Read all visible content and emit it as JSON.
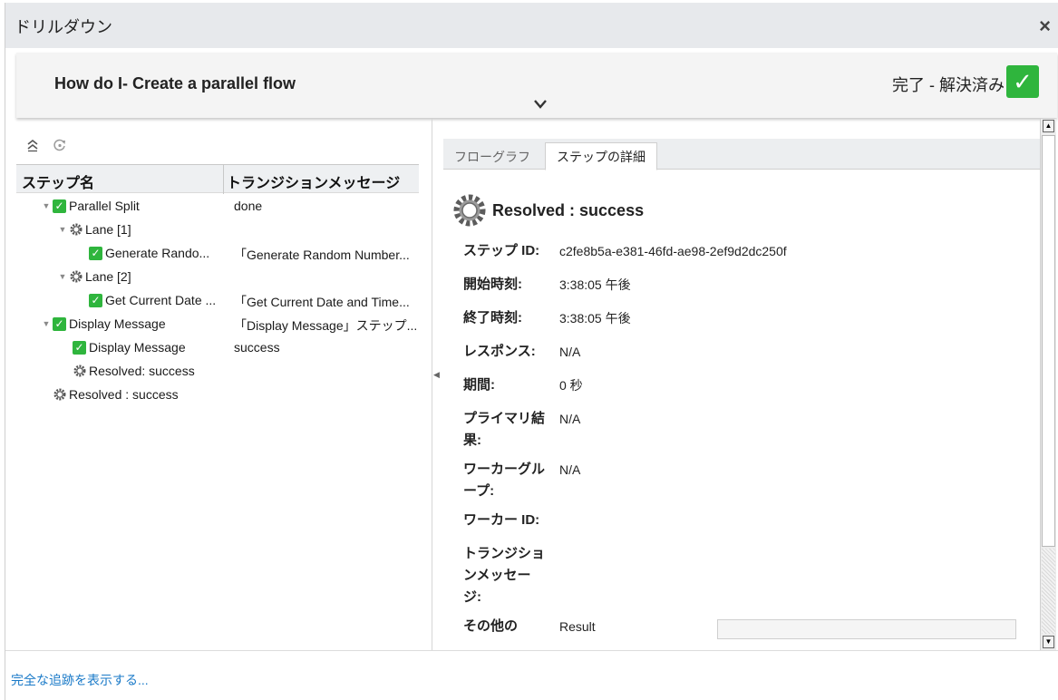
{
  "dialog": {
    "title": "ドリルダウン",
    "close_glyph": "×"
  },
  "header": {
    "flow_title": "How do I- Create a parallel flow",
    "status_text": "完了 - 解決済み",
    "status_glyph": "✓",
    "status_color": "#2fb53d"
  },
  "step_grid": {
    "col_step_name": "ステップ名",
    "col_transition": "トランジションメッセージ",
    "rows": [
      {
        "name": "Parallel Split",
        "message": "done"
      },
      {
        "name": "Lane [1]",
        "message": ""
      },
      {
        "name": "Generate Rando...",
        "message": "「Generate Random Number..."
      },
      {
        "name": "Lane [2]",
        "message": ""
      },
      {
        "name": "Get Current Date ...",
        "message": "「Get Current Date and Time..."
      },
      {
        "name": "Display Message",
        "message": "「Display Message」ステップ..."
      },
      {
        "name": "Display Message",
        "message": "success"
      },
      {
        "name": "Resolved: success",
        "message": ""
      },
      {
        "name": "Resolved : success",
        "message": ""
      }
    ]
  },
  "tabs": [
    {
      "label": "フローグラフ"
    },
    {
      "label": "ステップの詳細"
    }
  ],
  "details": {
    "title": "Resolved : success",
    "step_id_label": "ステップ ID:",
    "step_id_value": "c2fe8b5a-e381-46fd-ae98-2ef9d2dc250f",
    "start_label": "開始時刻:",
    "start_value": "3:38:05 午後",
    "end_label": "終了時刻:",
    "end_value": "3:38:05 午後",
    "response_label": "レスポンス:",
    "response_value": "N/A",
    "duration_label": "期間:",
    "duration_value": "0 秒",
    "primary_label": "プライマリ結果:",
    "primary_value": "N/A",
    "worker_group_label": "ワーカーグループ:",
    "worker_group_value": "N/A",
    "worker_id_label": "ワーカー ID:",
    "transition_label": "トランジションメッセージ:",
    "other_label": "その他の",
    "other_value": "Result"
  },
  "footer": {
    "trace_link": "完全な追跡を表示する..."
  },
  "colors": {
    "success_green": "#2fb53d",
    "link_blue": "#1a7ac8"
  }
}
